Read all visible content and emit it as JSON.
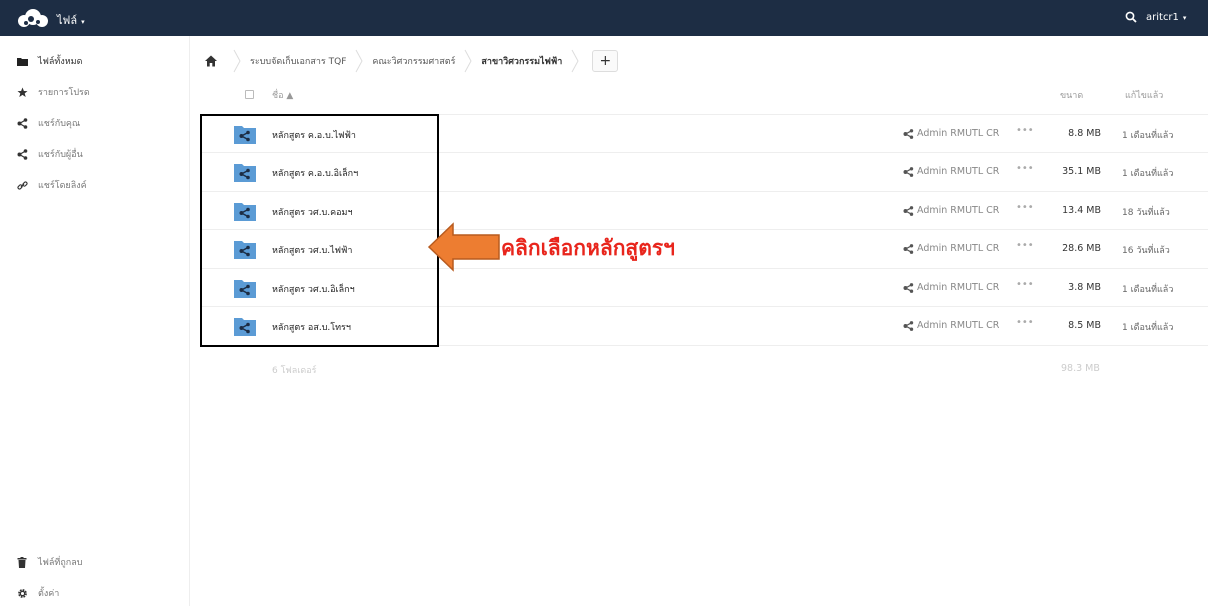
{
  "app": {
    "title": "ไฟล์",
    "caret": "▾",
    "user": "aritcr1"
  },
  "sidebar": {
    "items": [
      {
        "label": "ไฟล์ทั้งหมด",
        "icon": "folder-icon"
      },
      {
        "label": "รายการโปรด",
        "icon": "star-icon"
      },
      {
        "label": "แชร์กับคุณ",
        "icon": "share-icon"
      },
      {
        "label": "แชร์กับผู้อื่น",
        "icon": "share-icon"
      },
      {
        "label": "แชร์โดยลิงค์",
        "icon": "link-icon"
      }
    ],
    "bottom": [
      {
        "label": "ไฟล์ที่ถูกลบ",
        "icon": "trash-icon"
      },
      {
        "label": "ตั้งค่า",
        "icon": "gear-icon"
      }
    ]
  },
  "breadcrumb": {
    "items": [
      "ระบบจัดเก็บเอกสาร TQF",
      "คณะวิศวกรรมศาสตร์",
      "สาขาวิศวกรรมไฟฟ้า"
    ],
    "add": "+"
  },
  "table": {
    "headers": {
      "name": "ชื่อ ▲",
      "size": "ขนาด",
      "modified": "แก้ไขแล้ว"
    },
    "rows": [
      {
        "name": "หลักสูตร ค.อ.บ.ไฟฟ้า",
        "shared_by": "Admin RMUTL CR",
        "more": "•••",
        "size": "8.8 MB",
        "modified": "1 เดือนที่แล้ว"
      },
      {
        "name": "หลักสูตร ค.อ.บ.อิเล็กฯ",
        "shared_by": "Admin RMUTL CR",
        "more": "•••",
        "size": "35.1 MB",
        "modified": "1 เดือนที่แล้ว"
      },
      {
        "name": "หลักสูตร วศ.บ.คอมฯ",
        "shared_by": "Admin RMUTL CR",
        "more": "•••",
        "size": "13.4 MB",
        "modified": "18 วันที่แล้ว"
      },
      {
        "name": "หลักสูตร วศ.บ.ไฟฟ้า",
        "shared_by": "Admin RMUTL CR",
        "more": "•••",
        "size": "28.6 MB",
        "modified": "16 วันที่แล้ว"
      },
      {
        "name": "หลักสูตร วศ.บ.อิเล็กฯ",
        "shared_by": "Admin RMUTL CR",
        "more": "•••",
        "size": "3.8 MB",
        "modified": "1 เดือนที่แล้ว"
      },
      {
        "name": "หลักสูตร อส.บ.โทรฯ",
        "shared_by": "Admin RMUTL CR",
        "more": "•••",
        "size": "8.5 MB",
        "modified": "1 เดือนที่แล้ว"
      }
    ],
    "summary": {
      "count": "6 โฟลเดอร์",
      "size": "98.3 MB"
    }
  },
  "annotation": {
    "text": "คลิกเลือกหลักสูตรฯ",
    "text_color": "#e8251c",
    "arrow_color": "#ed7d31"
  },
  "colors": {
    "topbar": "#1d2d44",
    "folder": "#5b9bd5"
  }
}
